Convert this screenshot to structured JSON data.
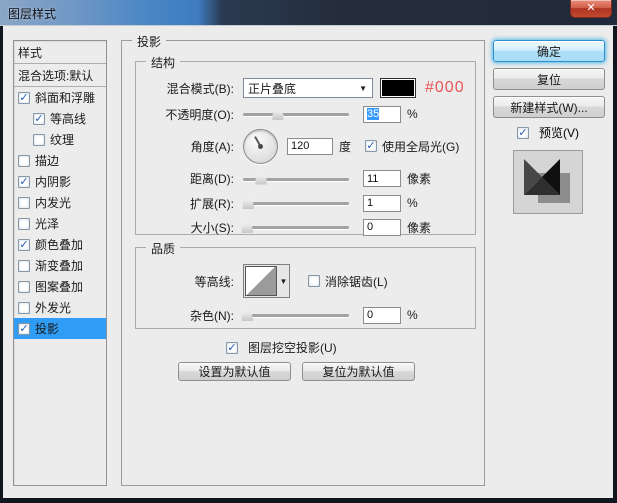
{
  "window": {
    "title": "图层样式"
  },
  "icons": {
    "close": "✕",
    "dropdown_arrow": "▼"
  },
  "colors": {
    "selection_blue": "#2f9cf5",
    "annotation_red": "#e85555",
    "blend_swatch": "#000000",
    "titlebar_blue": "#3f7dc0"
  },
  "sidebar": {
    "header": "样式",
    "blending_options": "混合选项:默认",
    "items": [
      {
        "label": "斜面和浮雕",
        "check": "✓"
      },
      {
        "label": "等高线",
        "check": "✓"
      },
      {
        "label": "纹理",
        "check": ""
      },
      {
        "label": "描边",
        "check": ""
      },
      {
        "label": "内阴影",
        "check": "✓"
      },
      {
        "label": "内发光",
        "check": ""
      },
      {
        "label": "光泽",
        "check": ""
      },
      {
        "label": "颜色叠加",
        "check": "✓"
      },
      {
        "label": "渐变叠加",
        "check": ""
      },
      {
        "label": "图案叠加",
        "check": ""
      },
      {
        "label": "外发光",
        "check": ""
      },
      {
        "label": "投影",
        "check": "✓"
      }
    ]
  },
  "panel": {
    "legend": "投影",
    "structure": {
      "legend": "结构",
      "blend_mode": {
        "label": "混合模式(B):",
        "value": "正片叠底",
        "annotation": "#000"
      },
      "opacity": {
        "label": "不透明度(O):",
        "value": "35",
        "unit": "%"
      },
      "angle": {
        "label": "角度(A):",
        "value": "120",
        "unit": "度",
        "global_light_label": "使用全局光(G)",
        "global_light_check": "✓"
      },
      "distance": {
        "label": "距离(D):",
        "value": "11",
        "unit": "像素"
      },
      "spread": {
        "label": "扩展(R):",
        "value": "1",
        "unit": "%"
      },
      "size": {
        "label": "大小(S):",
        "value": "0",
        "unit": "像素"
      }
    },
    "quality": {
      "legend": "品质",
      "contour": {
        "label": "等高线:",
        "anti_alias_label": "消除锯齿(L)",
        "anti_alias_check": ""
      },
      "noise": {
        "label": "杂色(N):",
        "value": "0",
        "unit": "%"
      }
    },
    "knockout": {
      "label": "图层挖空投影(U)",
      "check": "✓"
    },
    "footer_buttons": {
      "make_default": "设置为默认值",
      "reset_default": "复位为默认值"
    }
  },
  "actions": {
    "ok": "确定",
    "reset": "复位",
    "new_style": "新建样式(W)...",
    "preview_label": "预览(V)",
    "preview_check": "✓"
  }
}
